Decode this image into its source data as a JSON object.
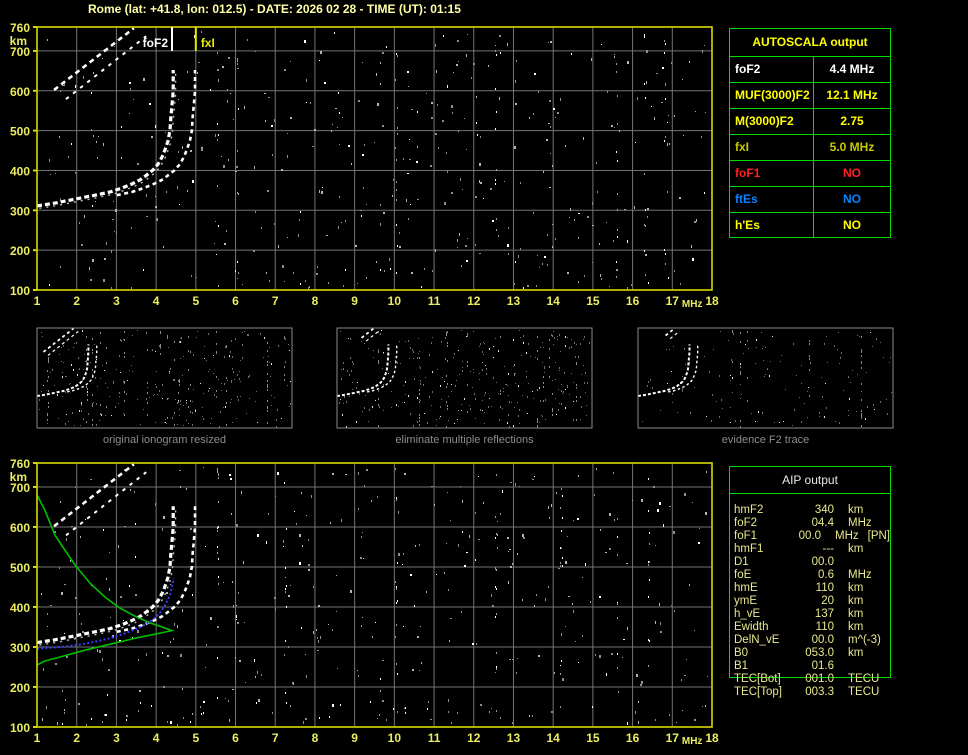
{
  "header": {
    "title": "Rome (lat: +41.8, lon: 012.5) - DATE: 2026 02 28 - TIME (UT): 01:15"
  },
  "autoscala_table": {
    "title": "AUTOSCALA output",
    "rows": [
      {
        "label": "foF2",
        "value": "4.4 MHz",
        "color": "#FFFFFF"
      },
      {
        "label": "MUF(3000)F2",
        "value": "12.1 MHz",
        "color": "#FFFF00"
      },
      {
        "label": "M(3000)F2",
        "value": "2.75",
        "color": "#FFFF00"
      },
      {
        "label": "fxI",
        "value": "5.0 MHz",
        "color": "#C9C900"
      },
      {
        "label": "foF1",
        "value": "NO",
        "color": "#FF2020"
      },
      {
        "label": "ftEs",
        "value": "NO",
        "color": "#0A82FF"
      },
      {
        "label": "h'Es",
        "value": "NO",
        "color": "#FFFF00"
      }
    ]
  },
  "aip_table": {
    "title": "AIP output",
    "rows": [
      {
        "label": "hmF2",
        "value": "340",
        "unit": "km",
        "extra": ""
      },
      {
        "label": "foF2",
        "value": "04.4",
        "unit": "MHz",
        "extra": ""
      },
      {
        "label": "foF1",
        "value": "00.0",
        "unit": "MHz",
        "extra": "[PN]"
      },
      {
        "label": "hmF1",
        "value": "---",
        "unit": "km",
        "extra": ""
      },
      {
        "label": "D1",
        "value": "00.0",
        "unit": "",
        "extra": ""
      },
      {
        "label": "foE",
        "value": "0.6",
        "unit": "MHz",
        "extra": ""
      },
      {
        "label": "hmE",
        "value": "110",
        "unit": "km",
        "extra": ""
      },
      {
        "label": "ymE",
        "value": "20",
        "unit": "km",
        "extra": ""
      },
      {
        "label": "h_vE",
        "value": "137",
        "unit": "km",
        "extra": ""
      },
      {
        "label": "Ewidth",
        "value": "110",
        "unit": "km",
        "extra": ""
      },
      {
        "label": "DelN_vE",
        "value": "00.0",
        "unit": "m^(-3)",
        "extra": ""
      },
      {
        "label": "B0",
        "value": "053.0",
        "unit": "km",
        "extra": ""
      },
      {
        "label": "B1",
        "value": "01.6",
        "unit": "",
        "extra": ""
      },
      {
        "label": "TEC[Bot]",
        "value": "001.0",
        "unit": "TECU",
        "extra": ""
      },
      {
        "label": "TEC[Top]",
        "value": "003.3",
        "unit": "TECU",
        "extra": ""
      }
    ]
  },
  "thumbnails": [
    {
      "caption": "original ionogram resized"
    },
    {
      "caption": "eliminate multiple reflections"
    },
    {
      "caption": "evidence F2 trace"
    }
  ],
  "colors": {
    "frame_yellow": "#D9D900",
    "tick_yellow": "#EDED60",
    "grid_gray": "#757575",
    "table_green": "#00DC00",
    "fof2_marker": "#FFFFFF",
    "fxi_marker": "#E8E800",
    "trace_white": "#FFFFFF",
    "profile_green": "#00BE00",
    "restored_blue": "#3A3AFF",
    "thumb_border": "#8A8A8A"
  },
  "chart_data": [
    {
      "id": "ionogram_top",
      "type": "scatter",
      "title": "Ionogram with AUTOSCALA interpretation",
      "xlabel": "MHz",
      "ylabel": "km",
      "xlim": [
        1,
        18
      ],
      "ylim": [
        100,
        760
      ],
      "x_ticks": [
        1,
        2,
        3,
        4,
        5,
        6,
        7,
        8,
        9,
        10,
        11,
        12,
        13,
        14,
        15,
        16,
        17,
        18
      ],
      "y_ticks": [
        760,
        700,
        600,
        500,
        400,
        300,
        200,
        100
      ],
      "grid": true,
      "markers": [
        {
          "label": "foF2",
          "mhz": 4.4,
          "color": "#FFFFFF",
          "side": "left"
        },
        {
          "label": "fxI",
          "mhz": 5.0,
          "color": "#E8E800",
          "side": "right"
        }
      ],
      "series": [
        {
          "name": "F2 O-mode trace",
          "points": [
            [
              1.0,
              311
            ],
            [
              1.45,
              318
            ],
            [
              1.96,
              328
            ],
            [
              2.46,
              338
            ],
            [
              2.84,
              346
            ],
            [
              3.14,
              356
            ],
            [
              3.39,
              366
            ],
            [
              3.59,
              376
            ],
            [
              3.77,
              389
            ],
            [
              3.92,
              401
            ],
            [
              4.05,
              416
            ],
            [
              4.15,
              434
            ],
            [
              4.22,
              451
            ],
            [
              4.3,
              474
            ],
            [
              4.35,
              501
            ],
            [
              4.37,
              532
            ],
            [
              4.4,
              564
            ],
            [
              4.43,
              599
            ],
            [
              4.43,
              632
            ],
            [
              4.43,
              652
            ]
          ]
        },
        {
          "name": "F2 X-mode trace",
          "derived_from": "F2 O-mode trace",
          "dx_mhz": 0.55,
          "from_index": 3
        },
        {
          "name": "second hop multiple",
          "segments": [
            [
              [
                1.43,
                602
              ],
              [
                3.44,
                757
              ]
            ],
            [
              [
                1.73,
                579
              ],
              [
                3.75,
                737
              ]
            ]
          ]
        }
      ],
      "noise_streaks_mhz": [
        5.55,
        6.05,
        10.05,
        12.55,
        15.6,
        16.3,
        16.8
      ]
    },
    {
      "id": "profile_bottom",
      "type": "scatter",
      "title": "Ionogram with AIP electron density profile",
      "xlabel": "MHz",
      "ylabel": "km",
      "xlim": [
        1,
        18
      ],
      "ylim": [
        100,
        760
      ],
      "x_ticks": [
        1,
        2,
        3,
        4,
        5,
        6,
        7,
        8,
        9,
        10,
        11,
        12,
        13,
        14,
        15,
        16,
        17,
        18
      ],
      "y_ticks": [
        760,
        700,
        600,
        500,
        400,
        300,
        200,
        100
      ],
      "grid": true,
      "markers": [],
      "series": [
        {
          "name": "electron density profile",
          "color": "green",
          "points": [
            [
              1.0,
              680
            ],
            [
              1.2,
              642
            ],
            [
              1.45,
              580
            ],
            [
              1.65,
              550
            ],
            [
              1.96,
              505
            ],
            [
              2.33,
              460
            ],
            [
              2.71,
              425
            ],
            [
              3.09,
              397
            ],
            [
              3.47,
              377
            ],
            [
              3.85,
              360
            ],
            [
              4.15,
              350
            ],
            [
              4.4,
              341
            ],
            [
              3.97,
              332
            ],
            [
              3.47,
              322
            ],
            [
              2.84,
              307
            ],
            [
              2.21,
              292
            ],
            [
              1.58,
              275
            ],
            [
              1.2,
              265
            ],
            [
              1.0,
              255
            ]
          ]
        },
        {
          "name": "restored O-mode trace",
          "color": "blue",
          "points": [
            [
              1.0,
              296
            ],
            [
              1.33,
              298
            ],
            [
              1.71,
              301
            ],
            [
              2.08,
              306
            ],
            [
              2.46,
              313
            ],
            [
              2.84,
              322
            ],
            [
              3.22,
              334
            ],
            [
              3.59,
              349
            ],
            [
              3.9,
              367
            ],
            [
              4.1,
              386
            ],
            [
              4.25,
              408
            ],
            [
              4.35,
              430
            ],
            [
              4.4,
              452
            ],
            [
              4.45,
              472
            ]
          ]
        }
      ],
      "noise_streaks_mhz": [
        5.55,
        7.25,
        10.05,
        12.55,
        14.2,
        15.6,
        16.4
      ]
    }
  ]
}
